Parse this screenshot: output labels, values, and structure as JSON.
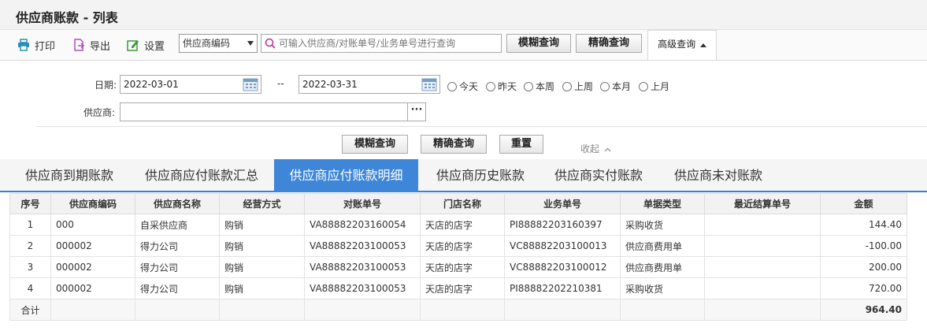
{
  "page": {
    "title": "供应商账款 - 列表"
  },
  "toolbar": {
    "print_label": "打印",
    "export_label": "导出",
    "settings_label": "设置",
    "search_field_selected": "供应商编码",
    "search_placeholder": "可输入供应商/对账单号/业务单号进行查询",
    "fuzzy_label": "模糊查询",
    "exact_label": "精确查询",
    "advanced_label": "高级查询"
  },
  "filters": {
    "date_label": "日期:",
    "date_from": "2022-03-01",
    "date_sep": "--",
    "date_to": "2022-03-31",
    "quick_dates": [
      "今天",
      "昨天",
      "本周",
      "上周",
      "本月",
      "上月"
    ],
    "supplier_label": "供应商:",
    "supplier_value": "",
    "supplier_more": "···",
    "fuzzy_label": "模糊查询",
    "exact_label": "精确查询",
    "reset_label": "重置",
    "collapse_label": "收起"
  },
  "tabs": [
    "供应商到期账款",
    "供应商应付账款汇总",
    "供应商应付账款明细",
    "供应商历史账款",
    "供应商实付账款",
    "供应商未对账款"
  ],
  "active_tab": 2,
  "table": {
    "headers": [
      "序号",
      "供应商编码",
      "供应商名称",
      "经营方式",
      "对账单号",
      "门店名称",
      "业务单号",
      "单据类型",
      "最近结算单号",
      "金额"
    ],
    "rows": [
      [
        "1",
        "000",
        "自采供应商",
        "购销",
        "VA88882203160054",
        "天店的店字",
        "PI88882203160397",
        "采购收货",
        "",
        "144.40"
      ],
      [
        "2",
        "000002",
        "得力公司",
        "购销",
        "VA88882203100053",
        "天店的店字",
        "VC88882203100013",
        "供应商费用单",
        "",
        "-100.00"
      ],
      [
        "3",
        "000002",
        "得力公司",
        "购销",
        "VA88882203100053",
        "天店的店字",
        "VC88882203100012",
        "供应商费用单",
        "",
        "200.00"
      ],
      [
        "4",
        "000002",
        "得力公司",
        "购销",
        "VA88882203100053",
        "天店的店字",
        "PI88882202210381",
        "采购收货",
        "",
        "720.00"
      ]
    ],
    "total_label": "合计",
    "total_amount": "964.40"
  },
  "colors": {
    "accent": "#3d86d8",
    "link": "#2a6fb8"
  },
  "icons": [
    "printer-icon",
    "export-icon",
    "settings-icon",
    "search-icon",
    "calendar-icon",
    "caret-up-icon",
    "chevron-up-icon"
  ]
}
